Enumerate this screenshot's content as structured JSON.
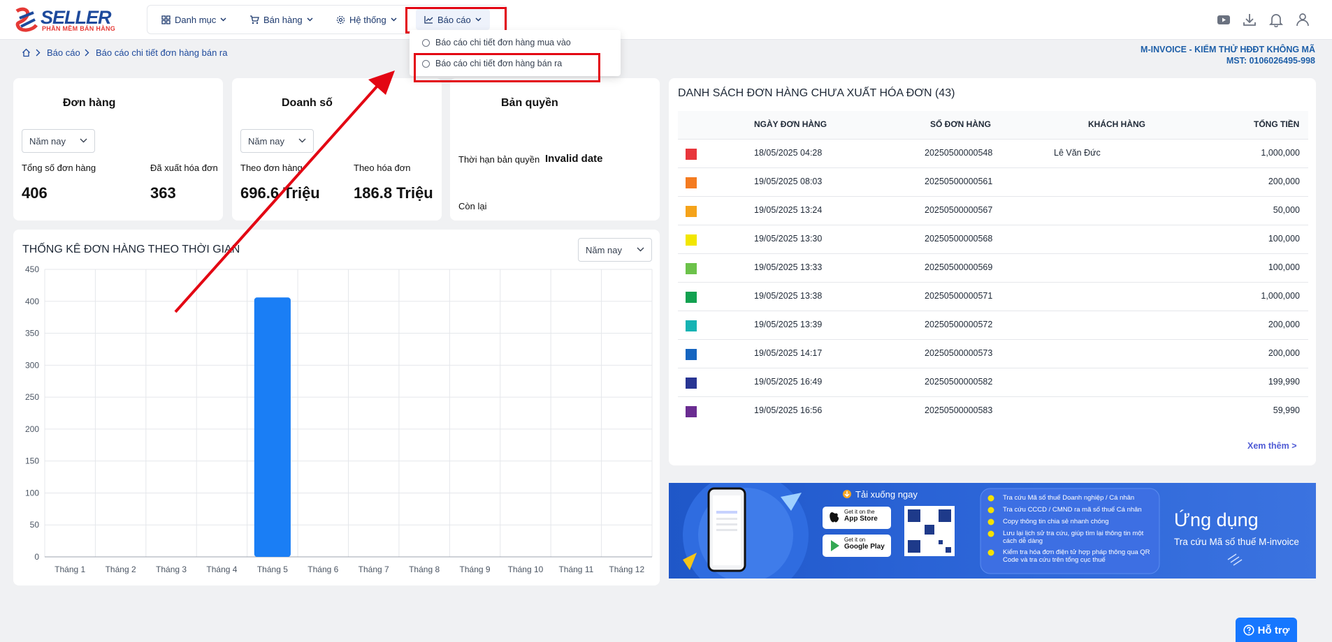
{
  "logo": {
    "title": "SELLER",
    "subtitle": "PHẦN MỀM BÁN HÀNG"
  },
  "nav": {
    "items": [
      {
        "label": "Danh mục"
      },
      {
        "label": "Bán hàng"
      },
      {
        "label": "Hệ thống"
      },
      {
        "label": "Báo cáo"
      }
    ]
  },
  "dropdown": {
    "items": [
      {
        "label": "Báo cáo chi tiết đơn hàng mua vào"
      },
      {
        "label": "Báo cáo chi tiết đơn hàng bán ra"
      }
    ]
  },
  "breadcrumb": {
    "items": [
      "Báo cáo",
      "Báo cáo chi tiết đơn hàng bán ra"
    ]
  },
  "company": {
    "name": "M-INVOICE - KIỂM THỬ HĐĐT KHÔNG MÃ",
    "mst": "MST: 0106026495-998"
  },
  "orders_card": {
    "title": "Đơn hàng",
    "filter": "Năm nay",
    "total_label": "Tổng số đơn hàng",
    "total_value": "406",
    "invoiced_label": "Đã xuất hóa đơn",
    "invoiced_value": "363"
  },
  "sales_card": {
    "title": "Doanh số",
    "filter": "Năm nay",
    "order_label": "Theo đơn hàng",
    "order_value": "696.6 Triệu",
    "invoice_label": "Theo hóa đơn",
    "invoice_value": "186.8 Triệu"
  },
  "license_card": {
    "title": "Bản quyền",
    "term_label": "Thời hạn bản quyền",
    "term_value": "Invalid date",
    "remaining_label": "Còn lại"
  },
  "chart_section": {
    "title": "THỐNG KÊ ĐƠN HÀNG THEO THỜI GIAN",
    "filter": "Năm nay"
  },
  "chart_data": {
    "type": "bar",
    "categories": [
      "Tháng 1",
      "Tháng 2",
      "Tháng 3",
      "Tháng 4",
      "Tháng 5",
      "Tháng 6",
      "Tháng 7",
      "Tháng 8",
      "Tháng 9",
      "Tháng 10",
      "Tháng 11",
      "Tháng 12"
    ],
    "values": [
      0,
      0,
      0,
      0,
      406,
      0,
      0,
      0,
      0,
      0,
      0,
      0
    ],
    "yticks": [
      0,
      50,
      100,
      150,
      200,
      250,
      300,
      350,
      400,
      450
    ],
    "ylim": [
      0,
      450
    ],
    "grid": true,
    "color": "#1a7ef5"
  },
  "table": {
    "title": "DANH SÁCH ĐƠN HÀNG CHƯA XUẤT HÓA ĐƠN (43)",
    "headers": [
      "NGÀY ĐƠN HÀNG",
      "SỐ ĐƠN HÀNG",
      "KHÁCH HÀNG",
      "TỔNG TIỀN"
    ],
    "rows": [
      {
        "color": "#e8363c",
        "date": "18/05/2025 04:28",
        "code": "20250500000548",
        "customer": "Lê Văn Đức",
        "total": "1,000,000"
      },
      {
        "color": "#f47b20",
        "date": "19/05/2025 08:03",
        "code": "20250500000561",
        "customer": "",
        "total": "200,000"
      },
      {
        "color": "#f5a31a",
        "date": "19/05/2025 13:24",
        "code": "20250500000567",
        "customer": "",
        "total": "50,000"
      },
      {
        "color": "#f2e600",
        "date": "19/05/2025 13:30",
        "code": "20250500000568",
        "customer": "",
        "total": "100,000"
      },
      {
        "color": "#6cc24a",
        "date": "19/05/2025 13:33",
        "code": "20250500000569",
        "customer": "",
        "total": "100,000"
      },
      {
        "color": "#12a150",
        "date": "19/05/2025 13:38",
        "code": "20250500000571",
        "customer": "",
        "total": "1,000,000"
      },
      {
        "color": "#16b3b3",
        "date": "19/05/2025 13:39",
        "code": "20250500000572",
        "customer": "",
        "total": "200,000"
      },
      {
        "color": "#1565c0",
        "date": "19/05/2025 14:17",
        "code": "20250500000573",
        "customer": "",
        "total": "200,000"
      },
      {
        "color": "#283593",
        "date": "19/05/2025 16:49",
        "code": "20250500000582",
        "customer": "",
        "total": "199,990"
      },
      {
        "color": "#6a2c91",
        "date": "19/05/2025 16:56",
        "code": "20250500000583",
        "customer": "",
        "total": "59,990"
      }
    ],
    "more": "Xem thêm >"
  },
  "banner": {
    "download": "Tải xuống ngay",
    "appstore_small": "Get it on the",
    "appstore_big": "App Store",
    "gplay_small": "Get it on",
    "gplay_big": "Google Play",
    "features": [
      "Tra cứu Mã số thuế Doanh nghiệp / Cá nhân",
      "Tra cứu CCCD / CMND ra mã số thuế Cá nhân",
      "Copy thông tin chia sẻ nhanh chóng",
      "Lưu lại lịch sử tra cứu, giúp tìm lại thông tin một cách dễ dàng",
      "Kiểm tra hóa đơn điện tử hợp pháp thông qua QR Code và tra cứu trên tổng cục thuế"
    ],
    "app_title": "Ứng dụng",
    "app_sub": "Tra cứu Mã số thuế M-invoice"
  },
  "help": {
    "label": "Hỗ trợ"
  }
}
